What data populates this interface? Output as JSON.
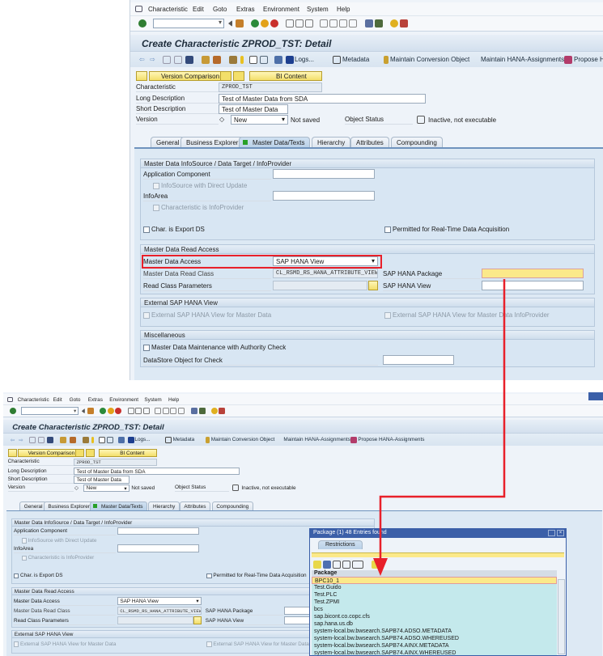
{
  "menu": [
    "Characteristic",
    "Edit",
    "Goto",
    "Extras",
    "Environment",
    "System",
    "Help"
  ],
  "title": "Create Characteristic ZPROD_TST: Detail",
  "app_toolbar": {
    "logs": "Logs...",
    "metadata": "Metadata",
    "conversion": "Maintain Conversion Object",
    "hana_assign": "Maintain HANA-Assignments",
    "propose": "Propose HANA-Assignments"
  },
  "buttons": {
    "version_comparison": "Version Comparison",
    "bi_content": "BI Content"
  },
  "header": {
    "characteristic_label": "Characteristic",
    "characteristic_value": "ZPROD_TST",
    "long_desc_label": "Long Description",
    "long_desc_value": "Test of Master Data from SDA",
    "short_desc_label": "Short Description",
    "short_desc_value": "Test of Master Data",
    "version_label": "Version",
    "version_value": "New",
    "save_status": "Not saved",
    "object_status_label": "Object Status",
    "object_status_value": "Inactive, not executable"
  },
  "tabs": [
    "General",
    "Business Explorer",
    "Master Data/Texts",
    "Hierarchy",
    "Attributes",
    "Compounding"
  ],
  "group_infosource": {
    "title": "Master Data InfoSource / Data Target / InfoProvider",
    "app_component": "Application Component",
    "infosource_direct": "InfoSource with Direct Update",
    "infoarea": "InfoArea",
    "char_infoprovider": "Characteristic is InfoProvider",
    "export_ds": "Char. is Export DS",
    "realtime": "Permitted for Real-Time Data Acquisition"
  },
  "group_read_access": {
    "title": "Master Data Read Access",
    "access_label": "Master Data Access",
    "access_value": "SAP HANA View",
    "class_label": "Master Data Read Class",
    "class_value": "CL_RSMD_RS_HANA_ATTRIBUTE_VIEW",
    "params_label": "Read Class Parameters",
    "package_label": "SAP HANA Package",
    "view_label": "SAP HANA View"
  },
  "group_external": {
    "title": "External SAP HANA View",
    "md": "External SAP HANA View for Master Data",
    "md_ip": "External SAP HANA View for Master Data InfoProvider"
  },
  "group_misc": {
    "title": "Miscellaneous",
    "authority": "Master Data Maintenance with Authority Check",
    "dso_label": "DataStore Object for Check"
  },
  "popup": {
    "title": "Package (1)   48 Entries found",
    "tab": "Restrictions",
    "column": "Package",
    "rows": [
      "BPC10_1",
      "Test.Guido",
      "Test.PLC",
      "Test.ZPMI",
      "bcs",
      "sap.bicont.co.copc.cfs",
      "sap.hana.us.db",
      "system-local.bw.bwsearch.SAPB74.ADSO.METADATA",
      "system-local.bw.bwsearch.SAPB74.ADSO.WHEREUSED",
      "system-local.bw.bwsearch.SAPB74.AINX.METADATA",
      "system-local.bw.bwsearch.SAPB74.AINX.WHEREUSED"
    ]
  },
  "colors": {
    "highlight": "#e8202a",
    "selected_row": "#fbe98a",
    "list_bg": "#c4e9ec",
    "popup_title": "#3b5fa8"
  }
}
